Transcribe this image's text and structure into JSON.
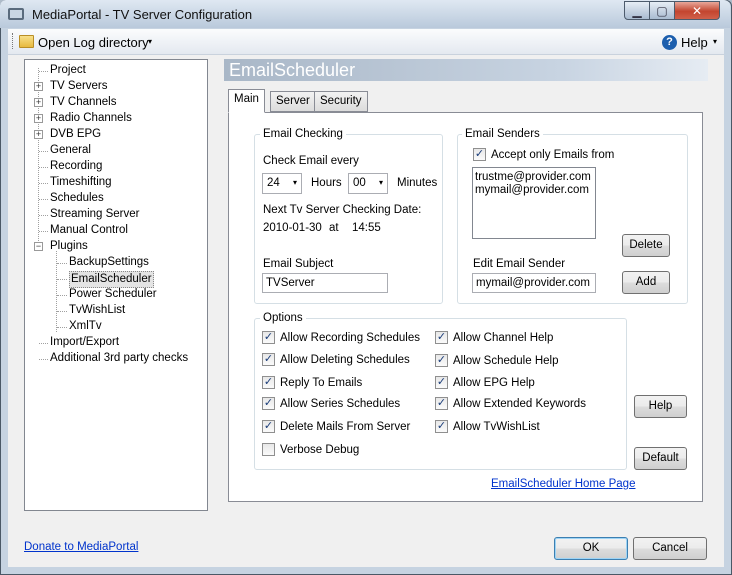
{
  "window": {
    "title": "MediaPortal - TV Server Configuration",
    "minimize_glyph": "▁",
    "maximize_glyph": "▢",
    "close_glyph": "✕"
  },
  "toolbar": {
    "open_log_label": "Open Log directory",
    "open_log_arrow": "▾",
    "help_icon_glyph": "?",
    "help_label": "Help",
    "help_arrow": "▾"
  },
  "tree": {
    "items": [
      {
        "label": "Project",
        "expander": ""
      },
      {
        "label": "TV Servers",
        "expander": "+"
      },
      {
        "label": "TV Channels",
        "expander": "+"
      },
      {
        "label": "Radio Channels",
        "expander": "+"
      },
      {
        "label": "DVB EPG",
        "expander": "+"
      },
      {
        "label": "General",
        "expander": ""
      },
      {
        "label": "Recording",
        "expander": ""
      },
      {
        "label": "Timeshifting",
        "expander": ""
      },
      {
        "label": "Schedules",
        "expander": ""
      },
      {
        "label": "Streaming Server",
        "expander": ""
      },
      {
        "label": "Manual Control",
        "expander": ""
      },
      {
        "label": "Plugins",
        "expander": "−"
      },
      {
        "label": "BackupSettings",
        "expander": ""
      },
      {
        "label": "EmailScheduler",
        "expander": ""
      },
      {
        "label": "Power Scheduler",
        "expander": ""
      },
      {
        "label": "TvWishList",
        "expander": ""
      },
      {
        "label": "XmlTv",
        "expander": ""
      },
      {
        "label": "Import/Export",
        "expander": ""
      },
      {
        "label": "Additional 3rd party checks",
        "expander": ""
      }
    ],
    "selected": "EmailScheduler"
  },
  "main": {
    "header": "EmailScheduler",
    "tabs": [
      "Main",
      "Server",
      "Security"
    ],
    "active_tab": "Main",
    "email_checking": {
      "legend": "Email Checking",
      "check_every_label": "Check Email every",
      "hours_value": "24",
      "hours_label": "Hours",
      "minutes_value": "00",
      "minutes_label": "Minutes",
      "next_date_label": "Next Tv Server Checking Date:",
      "next_date": "2010-01-30",
      "at_label": "at",
      "next_time": "14:55",
      "subject_label": "Email Subject",
      "subject_value": "TVServer",
      "arrow": "▾"
    },
    "email_senders": {
      "legend": "Email Senders",
      "accept_only_label": "Accept only Emails from",
      "accept_only_checked": true,
      "senders": [
        "trustme@provider.com",
        "mymail@provider.com"
      ],
      "delete_label": "Delete",
      "edit_label": "Edit Email Sender",
      "edit_value": "mymail@provider.com",
      "add_label": "Add"
    },
    "options": {
      "legend": "Options",
      "left": [
        {
          "label": "Allow Recording Schedules",
          "checked": true
        },
        {
          "label": "Allow Deleting Schedules",
          "checked": true
        },
        {
          "label": "Reply To Emails",
          "checked": true
        },
        {
          "label": "Allow Series Schedules",
          "checked": true
        },
        {
          "label": "Delete Mails From Server",
          "checked": true
        },
        {
          "label": "Verbose Debug",
          "checked": false
        }
      ],
      "right": [
        {
          "label": "Allow Channel Help",
          "checked": true
        },
        {
          "label": "Allow Schedule Help",
          "checked": true
        },
        {
          "label": "Allow EPG Help",
          "checked": true
        },
        {
          "label": "Allow Extended Keywords",
          "checked": true
        },
        {
          "label": "Allow TvWishList",
          "checked": true
        }
      ]
    },
    "help_button": "Help",
    "default_button": "Default",
    "home_page_link": "EmailScheduler Home Page",
    "check_glyph": "✓"
  },
  "footer": {
    "donate_link": "Donate to MediaPortal",
    "ok_label": "OK",
    "cancel_label": "Cancel"
  },
  "colors": {
    "header_text": "#ffffff",
    "link": "#0033cc",
    "checkmark": "#1a3c78"
  }
}
